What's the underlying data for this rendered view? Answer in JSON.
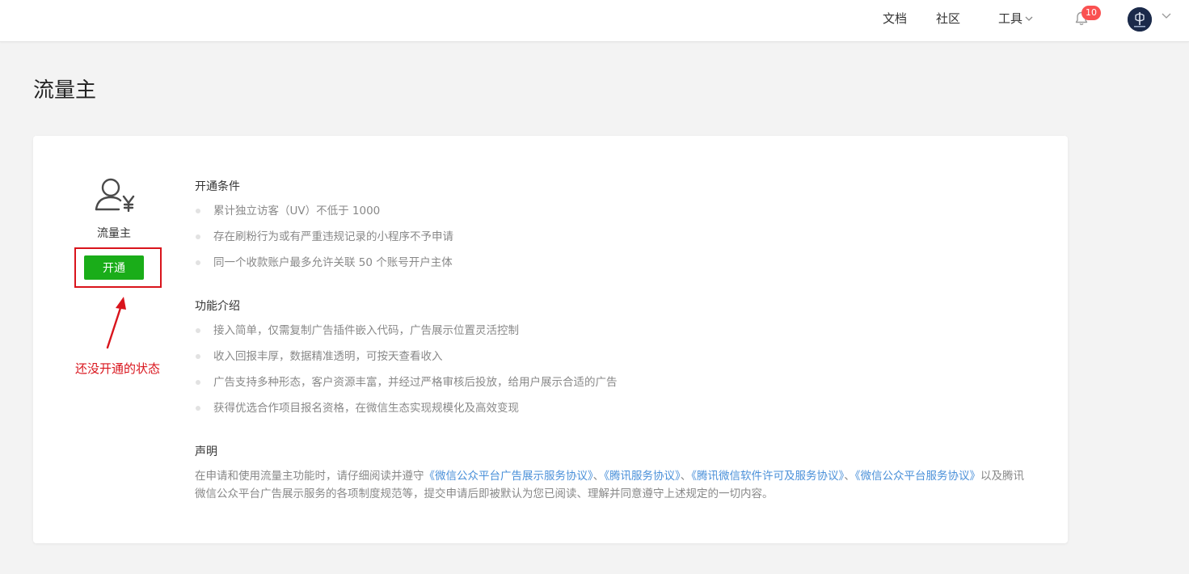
{
  "header": {
    "nav": {
      "docs": "文档",
      "community": "社区",
      "tools": "工具"
    },
    "notifications_count": "10",
    "icons": {
      "bell": "bell-icon",
      "tools_dropdown": "chevron-down-icon",
      "account_dropdown": "chevron-down-icon",
      "avatar": "user-avatar"
    }
  },
  "page": {
    "title": "流量主"
  },
  "card": {
    "role_icon": "user-yuan-icon",
    "role_label": "流量主",
    "open_button": "开通",
    "annotation": "还没开通的状态",
    "sections": {
      "conditions": {
        "title": "开通条件",
        "items": [
          "累计独立访客（UV）不低于 1000",
          "存在刷粉行为或有严重违规记录的小程序不予申请",
          "同一个收款账户最多允许关联 50 个账号开户主体"
        ]
      },
      "features": {
        "title": "功能介绍",
        "items": [
          "接入简单，仅需复制广告插件嵌入代码，广告展示位置灵活控制",
          "收入回报丰厚，数据精准透明，可按天查看收入",
          "广告支持多种形态，客户资源丰富，并经过严格审核后投放，给用户展示合适的广告",
          "获得优选合作项目报名资格，在微信生态实现规模化及高效变现"
        ]
      },
      "statement": {
        "title": "声明",
        "prefix": "在申请和使用流量主功能时，请仔细阅读并遵守",
        "links": [
          "《微信公众平台广告展示服务协议》",
          "《腾讯服务协议》",
          "《腾讯微信软件许可及服务协议》",
          "《微信公众平台服务协议》"
        ],
        "separator": "、",
        "suffix": "以及腾讯微信公众平台广告展示服务的各项制度规范等，提交申请后即被默认为您已阅读、理解并同意遵守上述规定的一切内容。"
      }
    }
  },
  "colors": {
    "primary_green": "#1aad19",
    "annotation_red": "#d9141c",
    "badge_red": "#fa5151",
    "link_blue": "#4a90d9"
  }
}
